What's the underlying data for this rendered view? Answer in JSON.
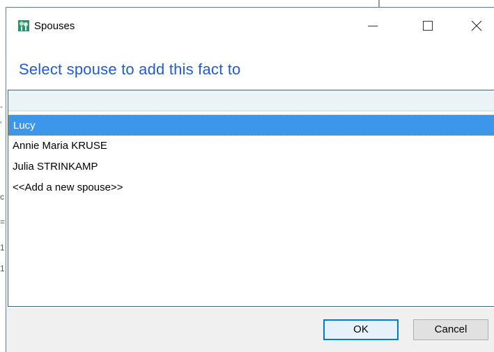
{
  "window": {
    "title": "Spouses",
    "icon": "family-tree-app-icon",
    "controls": [
      "minimize",
      "maximize",
      "close"
    ]
  },
  "prompt": "Select spouse to add this fact to",
  "list": {
    "search_value": "",
    "items": [
      {
        "label": "Lucy",
        "selected": true
      },
      {
        "label": "Annie Maria KRUSE",
        "selected": false
      },
      {
        "label": "Julia STRINKAMP",
        "selected": false
      },
      {
        "label": "<<Add a new spouse>>",
        "selected": false
      }
    ]
  },
  "buttons": {
    "ok": "OK",
    "cancel": "Cancel"
  },
  "colors": {
    "prompt_text": "#1f5bd1",
    "selection": "#3c97ea",
    "footer": "#f0f0f0",
    "default_button_border": "#0078d7"
  }
}
